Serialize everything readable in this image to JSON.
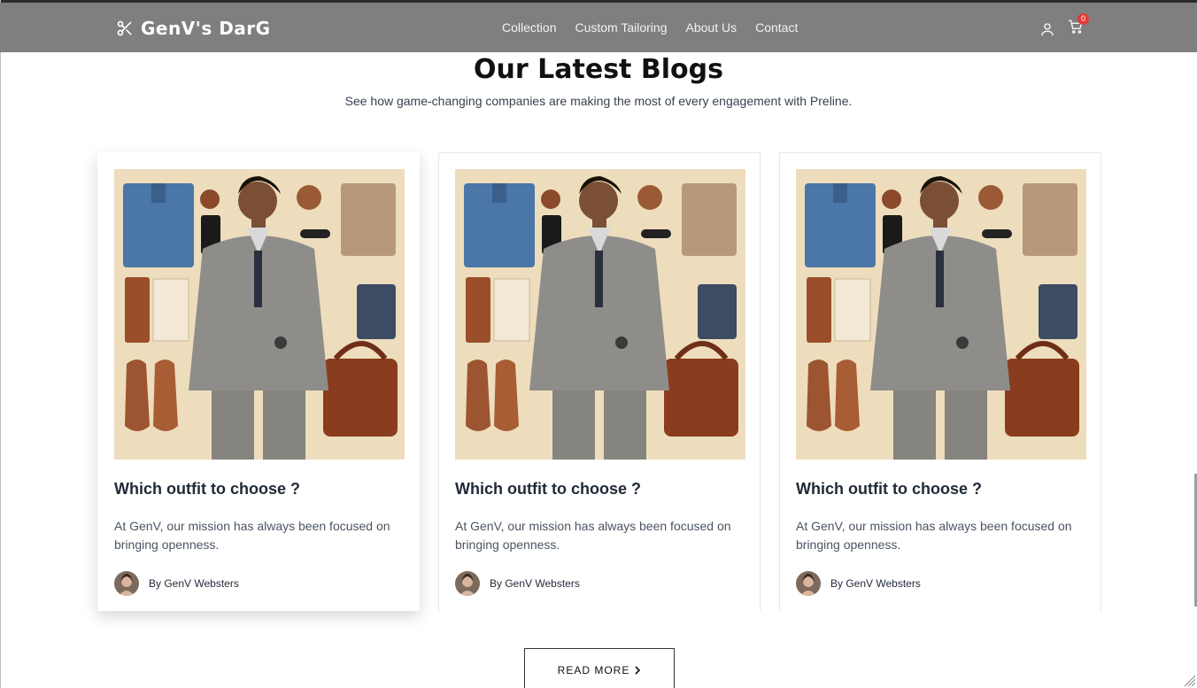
{
  "brand": {
    "name": "GenV's DarG",
    "logo_icon": "scissors-icon"
  },
  "nav": {
    "links": [
      "Collection",
      "Custom Tailoring",
      "About Us",
      "Contact"
    ],
    "user_icon": "user-icon",
    "cart_icon": "cart-icon",
    "cart_count": "0"
  },
  "section": {
    "title": "Our Latest Blogs",
    "subtitle": "See how game-changing companies are making the most of every engagement with Preline."
  },
  "cards": [
    {
      "title": "Which outfit to choose ?",
      "text": "At GenV, our mission has always been focused on bringing openness.",
      "author": "By GenV Websters"
    },
    {
      "title": "Which outfit to choose ?",
      "text": "At GenV, our mission has always been focused on bringing openness.",
      "author": "By GenV Websters"
    },
    {
      "title": "Which outfit to choose ?",
      "text": "At GenV, our mission has always been focused on bringing openness.",
      "author": "By GenV Websters"
    }
  ],
  "read_more": {
    "label": "READ MORE"
  },
  "colors": {
    "navbar": "#7f7f7f",
    "badge": "#e53935",
    "image_bg": "#eeddbd"
  }
}
